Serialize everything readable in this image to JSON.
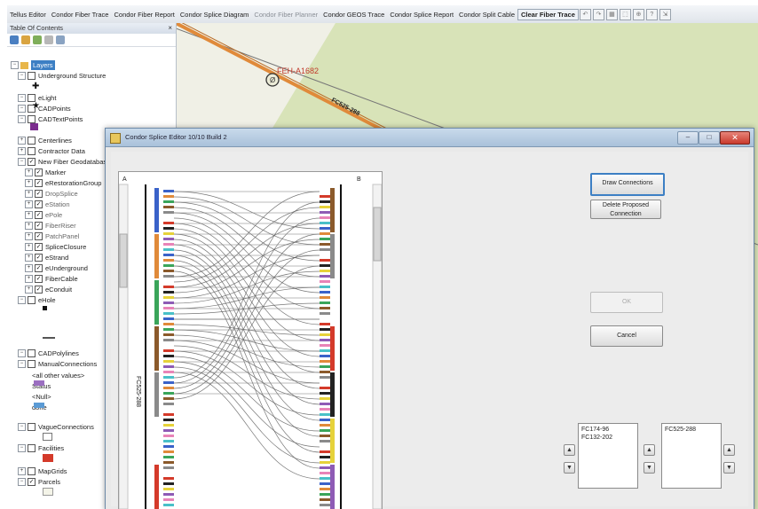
{
  "toolbar": {
    "items": [
      {
        "label": "Tellus Editor",
        "state": "normal"
      },
      {
        "label": "Condor Fiber Trace",
        "state": "normal"
      },
      {
        "label": "Condor Fiber Report",
        "state": "normal"
      },
      {
        "label": "Condor Splice Diagram",
        "state": "normal"
      },
      {
        "label": "Condor Fiber Planner",
        "state": "dim"
      },
      {
        "label": "Condor GEOS Trace",
        "state": "normal"
      },
      {
        "label": "Condor Splice Report",
        "state": "normal"
      },
      {
        "label": "Condor Split Cable",
        "state": "normal"
      },
      {
        "label": "Clear Fiber Trace",
        "state": "bold"
      }
    ]
  },
  "toc": {
    "title": "Table Of Contents",
    "close_glyph": "×",
    "rows": [
      {
        "label": "Layers",
        "expander": "−",
        "check": "",
        "indent": 0,
        "selected": true
      },
      {
        "label": "Underground Structure",
        "expander": "−",
        "check": " ",
        "indent": 1
      },
      {
        "label": "eLight",
        "expander": "−",
        "check": " ",
        "indent": 1
      },
      {
        "label": "CADPoints",
        "expander": "−",
        "check": " ",
        "indent": 1
      },
      {
        "label": "CADTextPoints",
        "expander": "−",
        "check": " ",
        "indent": 1
      },
      {
        "label": "Centerlines",
        "expander": "+",
        "check": " ",
        "indent": 1
      },
      {
        "label": "Contractor Data",
        "expander": "+",
        "check": " ",
        "indent": 1
      },
      {
        "label": "New Fiber Geodatabase",
        "expander": "−",
        "check": "✓",
        "indent": 1
      },
      {
        "label": "Marker",
        "expander": "+",
        "check": "✓",
        "indent": 2
      },
      {
        "label": "eRestorationGroup",
        "expander": "+",
        "check": "✓",
        "indent": 2
      },
      {
        "label": "DropSplice",
        "expander": "+",
        "check": "✓",
        "indent": 2,
        "dim": true
      },
      {
        "label": "eStation",
        "expander": "+",
        "check": "✓",
        "indent": 2,
        "dim": true
      },
      {
        "label": "ePole",
        "expander": "+",
        "check": "✓",
        "indent": 2,
        "dim": true
      },
      {
        "label": "FiberRiser",
        "expander": "+",
        "check": "✓",
        "indent": 2,
        "dim": true
      },
      {
        "label": "PatchPanel",
        "expander": "+",
        "check": "✓",
        "indent": 2,
        "dim": true
      },
      {
        "label": "SpliceClosure",
        "expander": "+",
        "check": "✓",
        "indent": 2
      },
      {
        "label": "eStrand",
        "expander": "+",
        "check": "✓",
        "indent": 2
      },
      {
        "label": "eUnderground",
        "expander": "+",
        "check": "✓",
        "indent": 2
      },
      {
        "label": "FiberCable",
        "expander": "+",
        "check": "✓",
        "indent": 2
      },
      {
        "label": "eConduit",
        "expander": "+",
        "check": "✓",
        "indent": 2
      },
      {
        "label": "eHole",
        "expander": "−",
        "check": " ",
        "indent": 1
      },
      {
        "label": "CADPolylines",
        "expander": "−",
        "check": " ",
        "indent": 1
      },
      {
        "label": "ManualConnections",
        "expander": "−",
        "check": " ",
        "indent": 1
      },
      {
        "label": "<all other values>",
        "expander": "",
        "check": "",
        "indent": 3
      },
      {
        "label": "Status",
        "expander": "",
        "check": "",
        "indent": 3
      },
      {
        "label": "<Null>",
        "expander": "",
        "check": "",
        "indent": 3
      },
      {
        "label": "done",
        "expander": "",
        "check": "",
        "indent": 3
      },
      {
        "label": "VagueConnections",
        "expander": "−",
        "check": " ",
        "indent": 1
      },
      {
        "label": "Facilities",
        "expander": "−",
        "check": " ",
        "indent": 1
      },
      {
        "label": "MapGrids",
        "expander": "+",
        "check": " ",
        "indent": 1
      },
      {
        "label": "Parcels",
        "expander": "−",
        "check": "✓",
        "indent": 1
      }
    ]
  },
  "map": {
    "feature_label": "FEH-A1682",
    "cable_label": "FC525-288"
  },
  "dialog": {
    "title": "Condor Splice Editor  10/10 Build 2",
    "close_glyph": "✕",
    "min_glyph": "–",
    "max_glyph": "□",
    "side_a_label": "A",
    "side_b_label": "B",
    "cable_vertical_label": "FC525-288",
    "buttons": {
      "draw_connections": "Draw Connections",
      "delete_proposed": "Delete Proposed Connection",
      "ok": "OK",
      "cancel": "Cancel"
    },
    "list_left": [
      "FC174-96",
      "FC132-202"
    ],
    "list_right": [
      "FC525-288"
    ],
    "arrow_up": "▲",
    "arrow_down": "▼"
  },
  "colors": {
    "map_green": "#d8e3b8",
    "cable_orange": "#e08a3a",
    "accent_blue": "#3c7fc4"
  }
}
